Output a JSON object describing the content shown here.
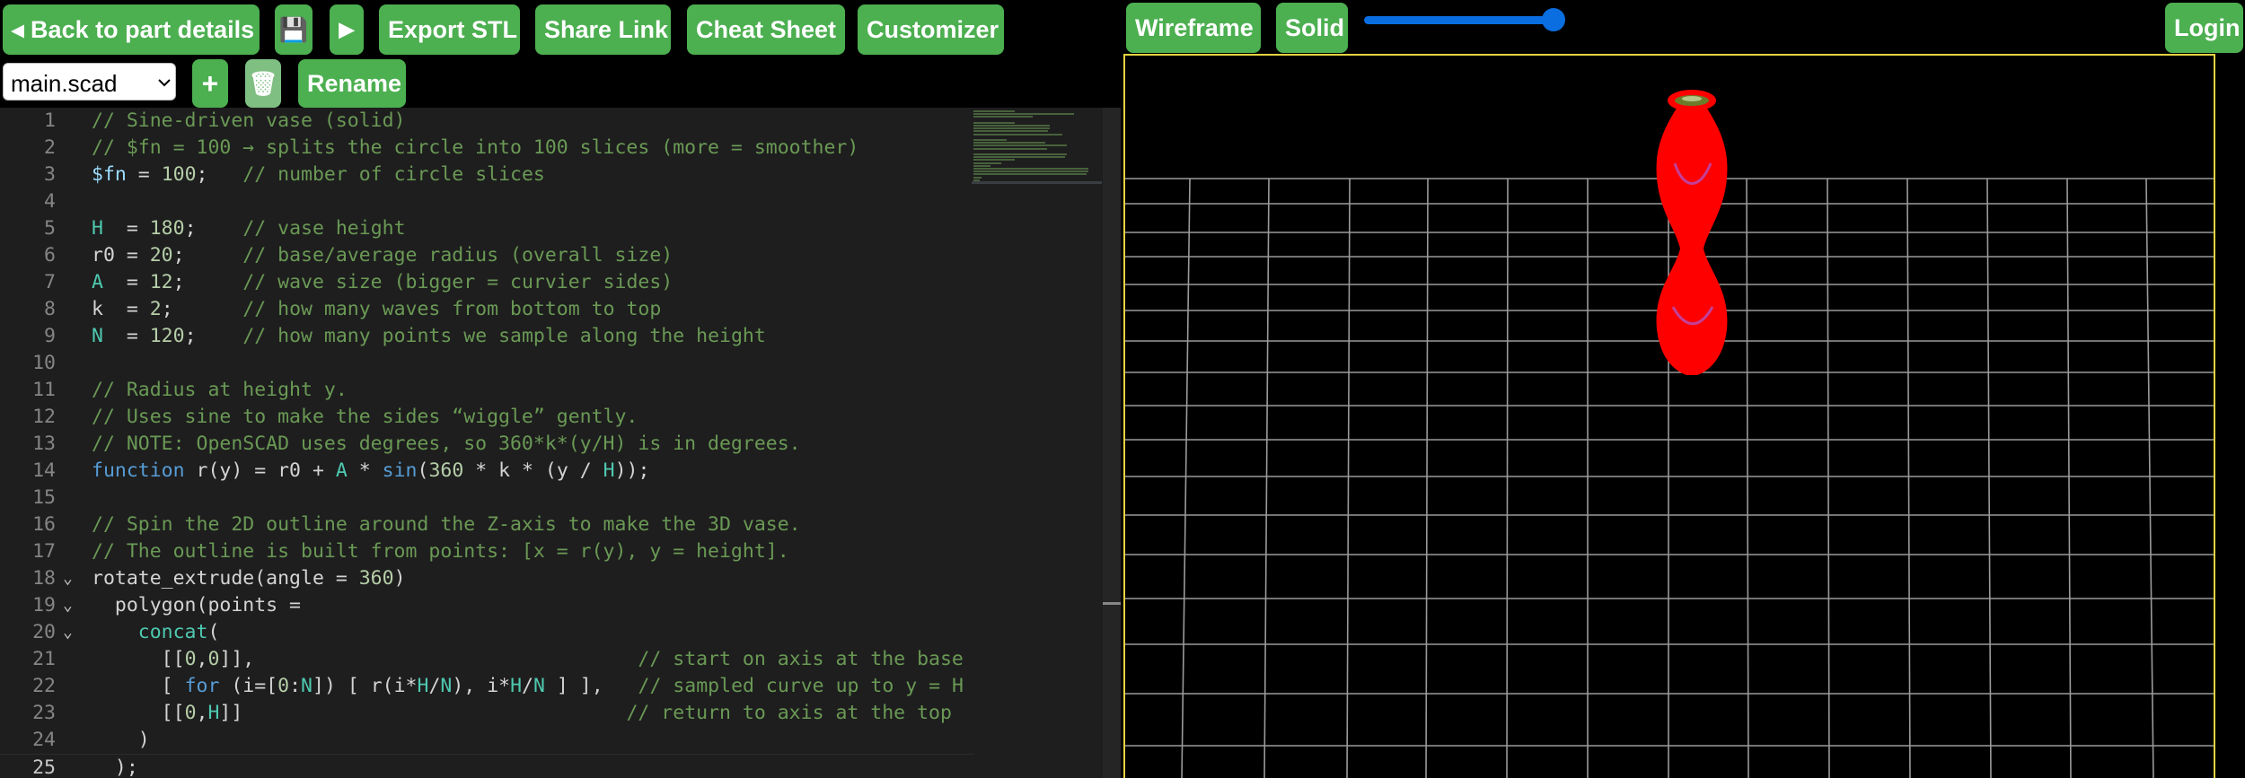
{
  "toolbar": {
    "back_label": "◂ Back to part details",
    "save_icon": "💾",
    "run_icon": "▶",
    "export_label": "Export STL",
    "share_label": "Share Link",
    "cheatsheet_label": "Cheat Sheet",
    "customizer_label": "Customizer"
  },
  "file_bar": {
    "selected_file": "main.scad",
    "add_icon": "+",
    "trash_icon": "🗑",
    "rename_label": "Rename"
  },
  "viewer": {
    "wireframe_label": "Wireframe",
    "solid_label": "Solid",
    "slider_value": 1.0,
    "login_label": "Login",
    "model_color": "#ff0000",
    "border_color": "#e5d341"
  },
  "colors": {
    "accent": "#4caf50",
    "slider": "#0a6ee0"
  },
  "editor": {
    "current_line": 25,
    "lines": [
      {
        "n": "1",
        "fold": "",
        "tokens": [
          [
            "c",
            "// Sine-driven vase (solid)"
          ]
        ]
      },
      {
        "n": "2",
        "fold": "",
        "tokens": [
          [
            "c",
            "// $fn = 100 → splits the circle into 100 slices (more = smoother)"
          ]
        ]
      },
      {
        "n": "3",
        "fold": "",
        "tokens": [
          [
            "v",
            "$fn"
          ],
          [
            "p",
            " = "
          ],
          [
            "n",
            "100"
          ],
          [
            "p",
            ";   "
          ],
          [
            "c",
            "// number of circle slices"
          ]
        ]
      },
      {
        "n": "4",
        "fold": "",
        "tokens": []
      },
      {
        "n": "5",
        "fold": "",
        "tokens": [
          [
            "i",
            "H"
          ],
          [
            "p",
            "  = "
          ],
          [
            "n",
            "180"
          ],
          [
            "p",
            ";    "
          ],
          [
            "c",
            "// vase height"
          ]
        ]
      },
      {
        "n": "6",
        "fold": "",
        "tokens": [
          [
            "p",
            "r0 = "
          ],
          [
            "n",
            "20"
          ],
          [
            "p",
            ";     "
          ],
          [
            "c",
            "// base/average radius (overall size)"
          ]
        ]
      },
      {
        "n": "7",
        "fold": "",
        "tokens": [
          [
            "i",
            "A"
          ],
          [
            "p",
            "  = "
          ],
          [
            "n",
            "12"
          ],
          [
            "p",
            ";     "
          ],
          [
            "c",
            "// wave size (bigger = curvier sides)"
          ]
        ]
      },
      {
        "n": "8",
        "fold": "",
        "tokens": [
          [
            "p",
            "k  = "
          ],
          [
            "n",
            "2"
          ],
          [
            "p",
            ";      "
          ],
          [
            "c",
            "// how many waves from bottom to top"
          ]
        ]
      },
      {
        "n": "9",
        "fold": "",
        "tokens": [
          [
            "i",
            "N"
          ],
          [
            "p",
            "  = "
          ],
          [
            "n",
            "120"
          ],
          [
            "p",
            ";    "
          ],
          [
            "c",
            "// how many points we sample along the height"
          ]
        ]
      },
      {
        "n": "10",
        "fold": "",
        "tokens": []
      },
      {
        "n": "11",
        "fold": "",
        "tokens": [
          [
            "c",
            "// Radius at height y."
          ]
        ]
      },
      {
        "n": "12",
        "fold": "",
        "tokens": [
          [
            "c",
            "// Uses sine to make the sides “wiggle” gently."
          ]
        ]
      },
      {
        "n": "13",
        "fold": "",
        "tokens": [
          [
            "c",
            "// NOTE: OpenSCAD uses degrees, so 360*k*(y/H) is in degrees."
          ]
        ]
      },
      {
        "n": "14",
        "fold": "",
        "tokens": [
          [
            "k",
            "function"
          ],
          [
            "p",
            " r(y) = r0 + "
          ],
          [
            "i",
            "A"
          ],
          [
            "p",
            " * "
          ],
          [
            "k",
            "sin"
          ],
          [
            "p",
            "("
          ],
          [
            "n",
            "360"
          ],
          [
            "p",
            " * k * (y / "
          ],
          [
            "i",
            "H"
          ],
          [
            "p",
            "));"
          ]
        ]
      },
      {
        "n": "15",
        "fold": "",
        "tokens": []
      },
      {
        "n": "16",
        "fold": "",
        "tokens": [
          [
            "c",
            "// Spin the 2D outline around the Z-axis to make the 3D vase."
          ]
        ]
      },
      {
        "n": "17",
        "fold": "",
        "tokens": [
          [
            "c",
            "// The outline is built from points: [x = r(y), y = height]."
          ]
        ]
      },
      {
        "n": "18",
        "fold": "⌄",
        "tokens": [
          [
            "p",
            "rotate_extrude(angle = "
          ],
          [
            "n",
            "360"
          ],
          [
            "p",
            ")"
          ]
        ]
      },
      {
        "n": "19",
        "fold": "⌄",
        "tokens": [
          [
            "p",
            "  polygon(points ="
          ]
        ]
      },
      {
        "n": "20",
        "fold": "⌄",
        "tokens": [
          [
            "p",
            "    "
          ],
          [
            "t",
            "concat"
          ],
          [
            "p",
            "("
          ]
        ]
      },
      {
        "n": "21",
        "fold": "",
        "tokens": [
          [
            "p",
            "      [["
          ],
          [
            "n",
            "0"
          ],
          [
            "p",
            ","
          ],
          [
            "n",
            "0"
          ],
          [
            "p",
            "]],                                 "
          ],
          [
            "c",
            "// start on axis at the base"
          ]
        ]
      },
      {
        "n": "22",
        "fold": "",
        "tokens": [
          [
            "p",
            "      [ "
          ],
          [
            "k",
            "for"
          ],
          [
            "p",
            " (i=["
          ],
          [
            "n",
            "0"
          ],
          [
            "p",
            ":"
          ],
          [
            "i",
            "N"
          ],
          [
            "p",
            "]) [ r(i*"
          ],
          [
            "i",
            "H"
          ],
          [
            "p",
            "/"
          ],
          [
            "i",
            "N"
          ],
          [
            "p",
            "), i*"
          ],
          [
            "i",
            "H"
          ],
          [
            "p",
            "/"
          ],
          [
            "i",
            "N"
          ],
          [
            "p",
            " ] ],   "
          ],
          [
            "c",
            "// sampled curve up to y = H"
          ]
        ]
      },
      {
        "n": "23",
        "fold": "",
        "tokens": [
          [
            "p",
            "      [["
          ],
          [
            "n",
            "0"
          ],
          [
            "p",
            ","
          ],
          [
            "i",
            "H"
          ],
          [
            "p",
            "]]                                 "
          ],
          [
            "c",
            "// return to axis at the top"
          ]
        ]
      },
      {
        "n": "24",
        "fold": "",
        "tokens": [
          [
            "p",
            "    )"
          ]
        ]
      },
      {
        "n": "25",
        "fold": "",
        "tokens": [
          [
            "p",
            "  );"
          ]
        ]
      }
    ]
  }
}
